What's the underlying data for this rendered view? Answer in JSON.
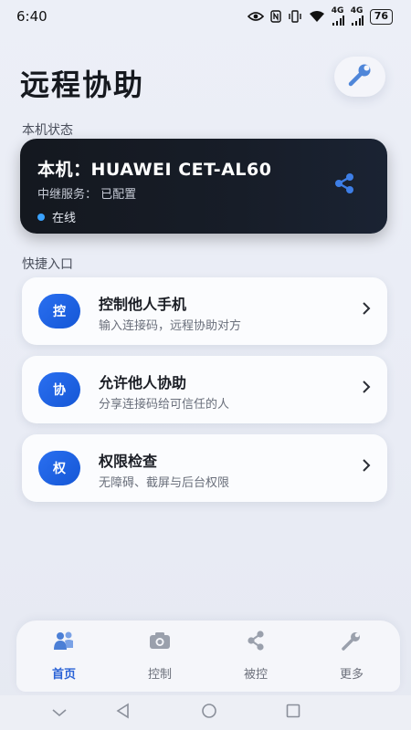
{
  "status_bar": {
    "time": "6:40",
    "net_1": "4G",
    "net_2": "4G",
    "battery": "76"
  },
  "header": {
    "title": "远程协助"
  },
  "device_section": {
    "label": "本机状态",
    "title": "本机：HUAWEI CET-AL60",
    "relay": "中继服务：  已配置",
    "status": "在线"
  },
  "quick_section": {
    "label": "快捷入口",
    "items": [
      {
        "badge": "控",
        "title": "控制他人手机",
        "subtitle": "输入连接码，远程协助对方"
      },
      {
        "badge": "协",
        "title": "允许他人协助",
        "subtitle": "分享连接码给可信任的人"
      },
      {
        "badge": "权",
        "title": "权限检查",
        "subtitle": "无障碍、截屏与后台权限"
      }
    ]
  },
  "tabbar": {
    "tabs": [
      {
        "label": "首页",
        "icon": "home-people-icon",
        "active": true
      },
      {
        "label": "控制",
        "icon": "camera-icon",
        "active": false
      },
      {
        "label": "被控",
        "icon": "share-icon",
        "active": false
      },
      {
        "label": "更多",
        "icon": "wrench-icon",
        "active": false
      }
    ]
  },
  "colors": {
    "accent": "#2a62d6",
    "badge": "#1f63e6",
    "dark_card": "#151a22",
    "online_dot": "#3aa2ff"
  }
}
